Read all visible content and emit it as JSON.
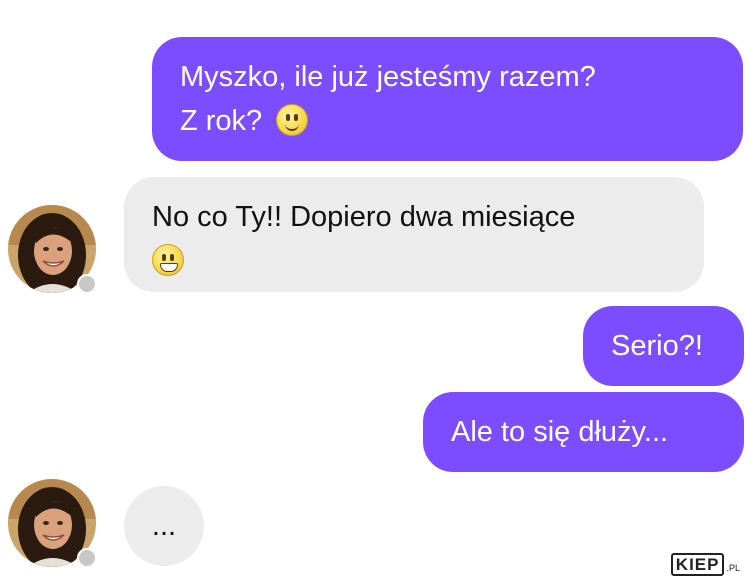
{
  "messages": [
    {
      "direction": "outgoing",
      "text_line1": "Myszko, ile już jesteśmy razem?",
      "text_line2": "Z rok?",
      "emoji": "slightly-smiling-face"
    },
    {
      "direction": "incoming",
      "text_line1": "No co Ty!! Dopiero dwa miesiące",
      "emoji": "grinning-face"
    },
    {
      "direction": "outgoing",
      "text": "Serio?!"
    },
    {
      "direction": "outgoing",
      "text": "Ale to się dłuży..."
    },
    {
      "direction": "incoming",
      "text": "...",
      "state": "typing"
    }
  ],
  "colors": {
    "outgoing_bubble": "#7c4dff",
    "incoming_bubble": "#ececec",
    "background": "#ffffff"
  },
  "watermark": {
    "main": "KIEP",
    "tld": ".PL"
  }
}
